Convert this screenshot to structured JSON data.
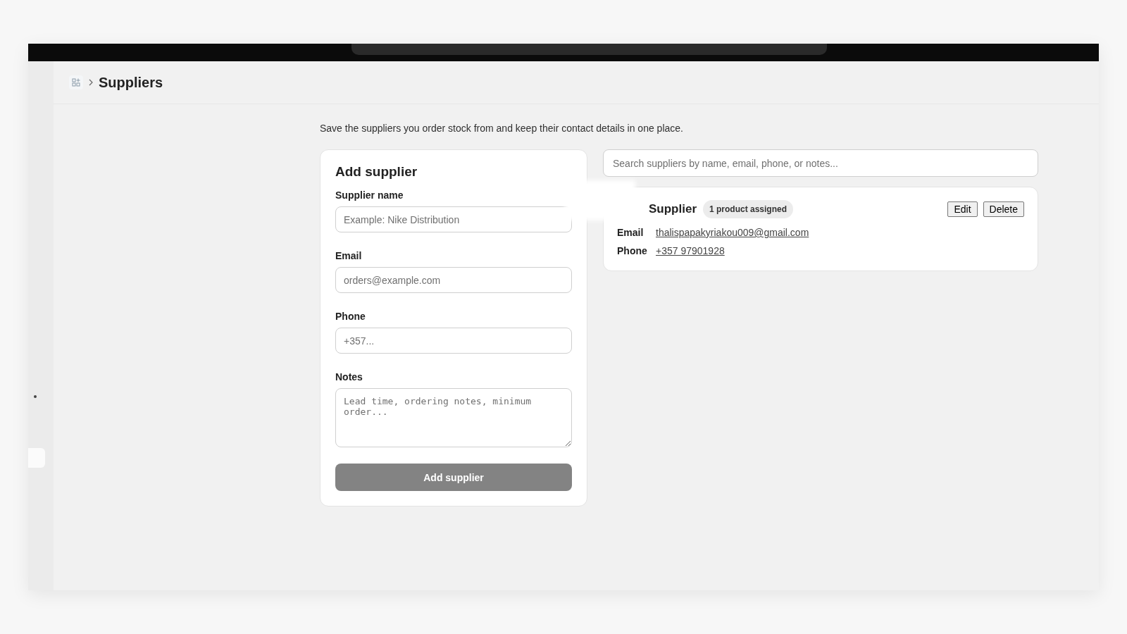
{
  "breadcrumb": {
    "title": "Suppliers"
  },
  "description": "Save the suppliers you order stock from and keep their contact details in one place.",
  "form": {
    "title": "Add supplier",
    "fields": [
      {
        "label": "Supplier name",
        "placeholder": "Example: Nike Distribution",
        "kind": "input"
      },
      {
        "label": "Email",
        "placeholder": "orders@example.com",
        "kind": "input"
      },
      {
        "label": "Phone",
        "placeholder": "+357...",
        "kind": "input"
      },
      {
        "label": "Notes",
        "placeholder": "Lead time, ordering notes, minimum order...",
        "kind": "textarea"
      }
    ],
    "submit": "Add supplier"
  },
  "search": {
    "placeholder": "Search suppliers by name, email, phone, or notes..."
  },
  "suppliers": [
    {
      "name": "Supplier",
      "badge": "1 product assigned",
      "actions": [
        "Edit",
        "Delete"
      ],
      "details": [
        {
          "label": "Email",
          "value": "thalispapakyriakou009@gmail.com"
        },
        {
          "label": "Phone",
          "value": "+357 97901928"
        }
      ]
    }
  ]
}
